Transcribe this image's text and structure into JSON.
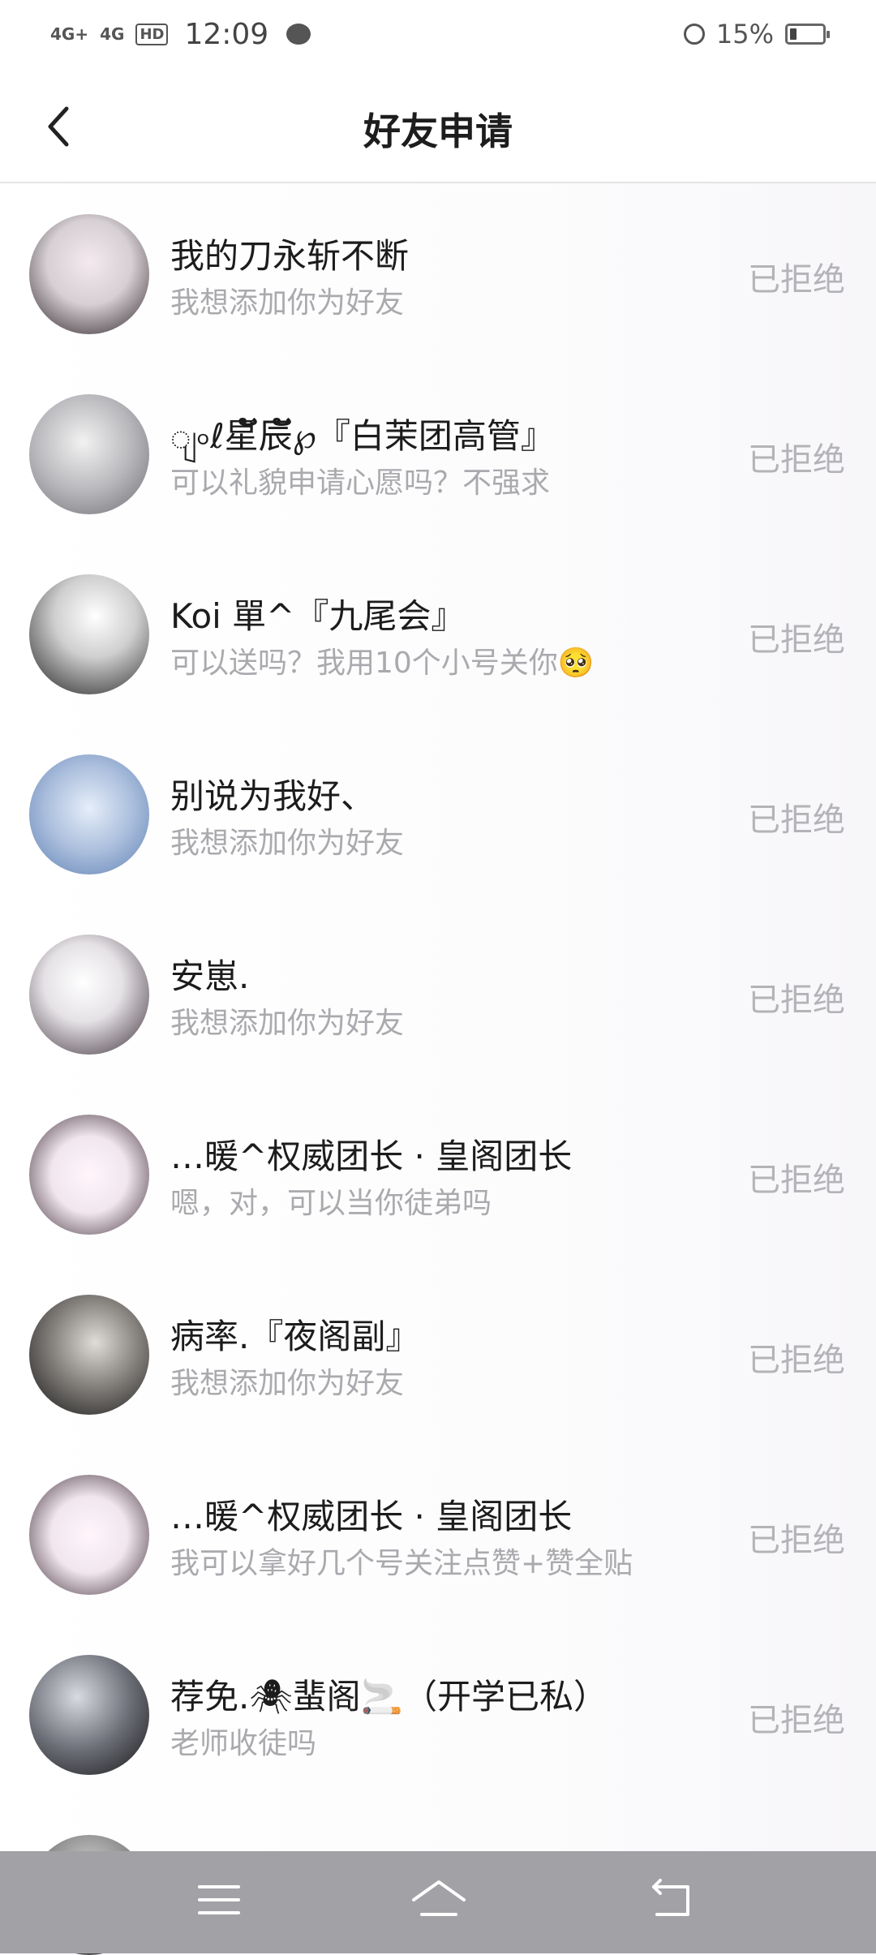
{
  "status_bar": {
    "signal1": "4G+",
    "signal2": "4G",
    "hd_label": "HD",
    "time": "12:09",
    "battery_percent": "15%"
  },
  "header": {
    "title": "好友申请"
  },
  "requests": [
    {
      "name": "我的刀永斩不断",
      "message": "我想添加你为好友",
      "status": "已拒绝",
      "avatar_color": "#d6cfd4"
    },
    {
      "name": "ျ৹ℓ星ັ辰ັ℘『白茉团高管』",
      "message": "可以礼貌申请心愿吗？不强求",
      "status": "已拒绝",
      "avatar_color": "#cfcfd2"
    },
    {
      "name": "Koi 單^『九尾会』",
      "message": "可以送吗？我用10个小号关你🥺",
      "status": "已拒绝",
      "avatar_color": "#bdbdbd"
    },
    {
      "name": "别说为我好、",
      "message": "我想添加你为好友",
      "status": "已拒绝",
      "avatar_color": "#a9bddc"
    },
    {
      "name": "安崽.",
      "message": "我想添加你为好友",
      "status": "已拒绝",
      "avatar_color": "#e5e2e6"
    },
    {
      "name": "…暖^权威团长 · 皇阁团长",
      "message": "嗯，对，可以当你徒弟吗",
      "status": "已拒绝",
      "avatar_color": "#f1e6ee"
    },
    {
      "name": "病率.『夜阁副』",
      "message": "我想添加你为好友",
      "status": "已拒绝",
      "avatar_color": "#6a6a6a"
    },
    {
      "name": "…暖^权威团长 · 皇阁团长",
      "message": "我可以拿好几个号关注点赞+赞全贴",
      "status": "已拒绝",
      "avatar_color": "#f1e6ee"
    },
    {
      "name": "荐免.🕷蜚阁🚬（开学已私）",
      "message": "老师收徒吗",
      "status": "已拒绝",
      "avatar_color": "#6d6f78"
    }
  ],
  "icons": {
    "back": "chevron-left-icon",
    "menu": "menu-icon",
    "home": "home-icon",
    "return": "return-icon"
  },
  "colors": {
    "status_text": "#b4b3b7",
    "message_text": "#aaa9ad",
    "navbar_bg": "#a2a1a6"
  }
}
